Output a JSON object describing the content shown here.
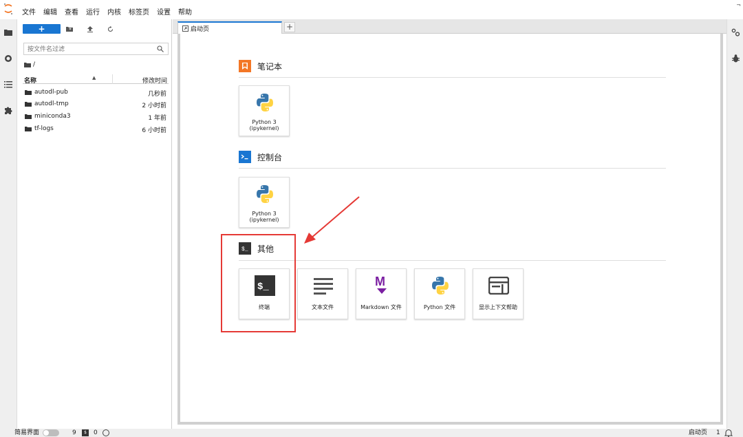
{
  "menu": [
    "文件",
    "编辑",
    "查看",
    "运行",
    "内核",
    "标签页",
    "设置",
    "帮助"
  ],
  "toolbar": {
    "new_label": "+"
  },
  "filter": {
    "placeholder": "按文件名过滤"
  },
  "breadcrumb": "/",
  "table": {
    "col_name": "名称",
    "col_modified": "修改时间",
    "rows": [
      {
        "name": "autodl-pub",
        "modified": "几秒前"
      },
      {
        "name": "autodl-tmp",
        "modified": "2 小时前"
      },
      {
        "name": "miniconda3",
        "modified": "1 年前"
      },
      {
        "name": "tf-logs",
        "modified": "6 小时前"
      }
    ]
  },
  "tab": {
    "label": "启动页",
    "add": "+"
  },
  "launcher": {
    "notebook": {
      "title": "笔记本",
      "cards": [
        {
          "line1": "Python 3",
          "line2": "(ipykernel)"
        }
      ]
    },
    "console": {
      "title": "控制台",
      "cards": [
        {
          "line1": "Python 3",
          "line2": "(ipykernel)"
        }
      ]
    },
    "other": {
      "title": "其他",
      "cards": [
        {
          "label": "终端",
          "icon": "terminal-icon"
        },
        {
          "label": "文本文件",
          "icon": "text-file-icon"
        },
        {
          "label": "Markdown 文件",
          "icon": "markdown-icon"
        },
        {
          "label": "Python 文件",
          "icon": "python-icon"
        },
        {
          "label": "显示上下文帮助",
          "icon": "context-help-icon"
        }
      ]
    }
  },
  "status": {
    "simple_mode": "简易界面",
    "count_a": "9",
    "count_b": "0",
    "right_label": "启动页",
    "right_count": "1"
  },
  "colors": {
    "accent": "#1976d2",
    "highlight": "#e53935",
    "notebook": "#f37726",
    "console": "#1976d2",
    "terminal": "#333333",
    "markdown": "#7b1fa2"
  }
}
